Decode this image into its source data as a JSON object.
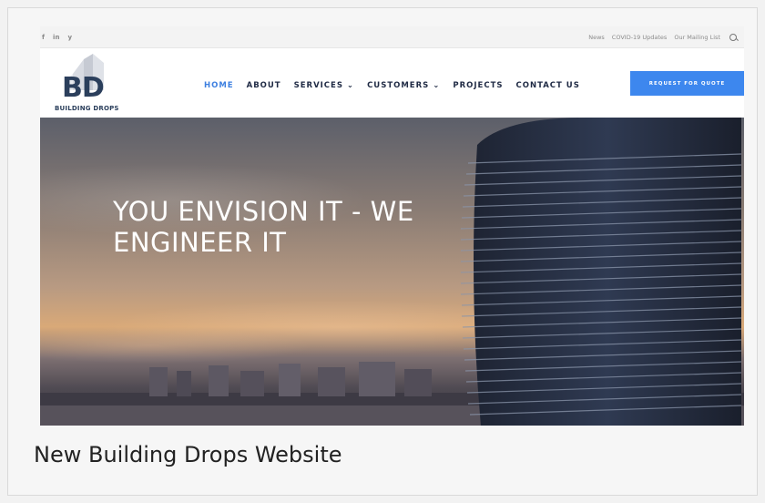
{
  "topbar": {
    "social": [
      {
        "icon": "facebook-icon",
        "glyph": "f"
      },
      {
        "icon": "linkedin-icon",
        "glyph": "in"
      },
      {
        "icon": "twitter-icon",
        "glyph": "y"
      }
    ],
    "links": [
      "News",
      "COVID-19 Updates",
      "Our Mailing List"
    ],
    "search_icon": "search-icon"
  },
  "logo": {
    "mark": "BD",
    "text": "BUILDING DROPS"
  },
  "nav": {
    "items": [
      "HOME",
      "ABOUT",
      "SERVICES ⌄",
      "CUSTOMERS ⌄",
      "PROJECTS",
      "CONTACT US"
    ],
    "active": "HOME"
  },
  "quote_button": "REQUEST FOR QUOTE",
  "hero": {
    "headline": "YOU ENVISION IT - WE ENGINEER IT"
  },
  "caption": "New Building Drops Website",
  "colors": {
    "accent": "#3d87ee",
    "nav_active": "#3d7fe0",
    "nav_text": "#1f2a44",
    "brand": "#2b3f5c"
  }
}
